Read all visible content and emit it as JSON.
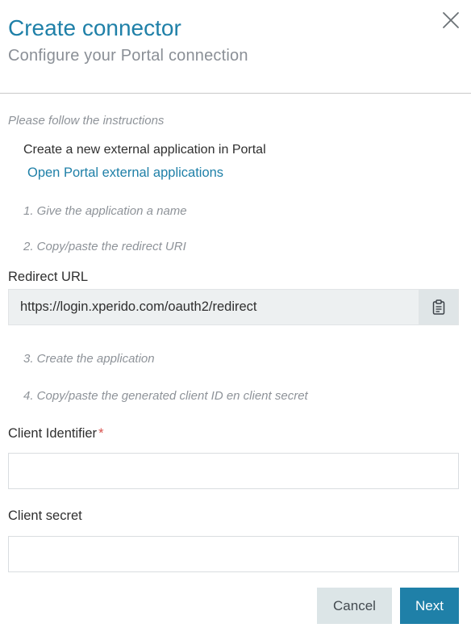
{
  "header": {
    "title": "Create connector",
    "subtitle": "Configure your Portal connection"
  },
  "instructions": {
    "intro": "Please follow the instructions",
    "create_app": "Create a new external application in Portal",
    "open_link": "Open Portal external applications",
    "step1": "1. Give the application a name",
    "step2": "2. Copy/paste the redirect URI",
    "step3": "3. Create the application",
    "step4": "4. Copy/paste the generated client ID en client secret"
  },
  "redirect": {
    "label": "Redirect URL",
    "value": "https://login.xperido.com/oauth2/redirect"
  },
  "client_id": {
    "label": "Client Identifier",
    "required_marker": "*",
    "value": ""
  },
  "client_secret": {
    "label": "Client secret",
    "value": ""
  },
  "actions": {
    "cancel_label": "Cancel",
    "next_label": "Next"
  },
  "icons": {
    "close": "close-icon",
    "copy": "clipboard-icon"
  },
  "colors": {
    "accent": "#1f80a8",
    "muted_text": "#8e9399",
    "required": "#d9534f",
    "cancel_bg": "#dce5e7"
  }
}
